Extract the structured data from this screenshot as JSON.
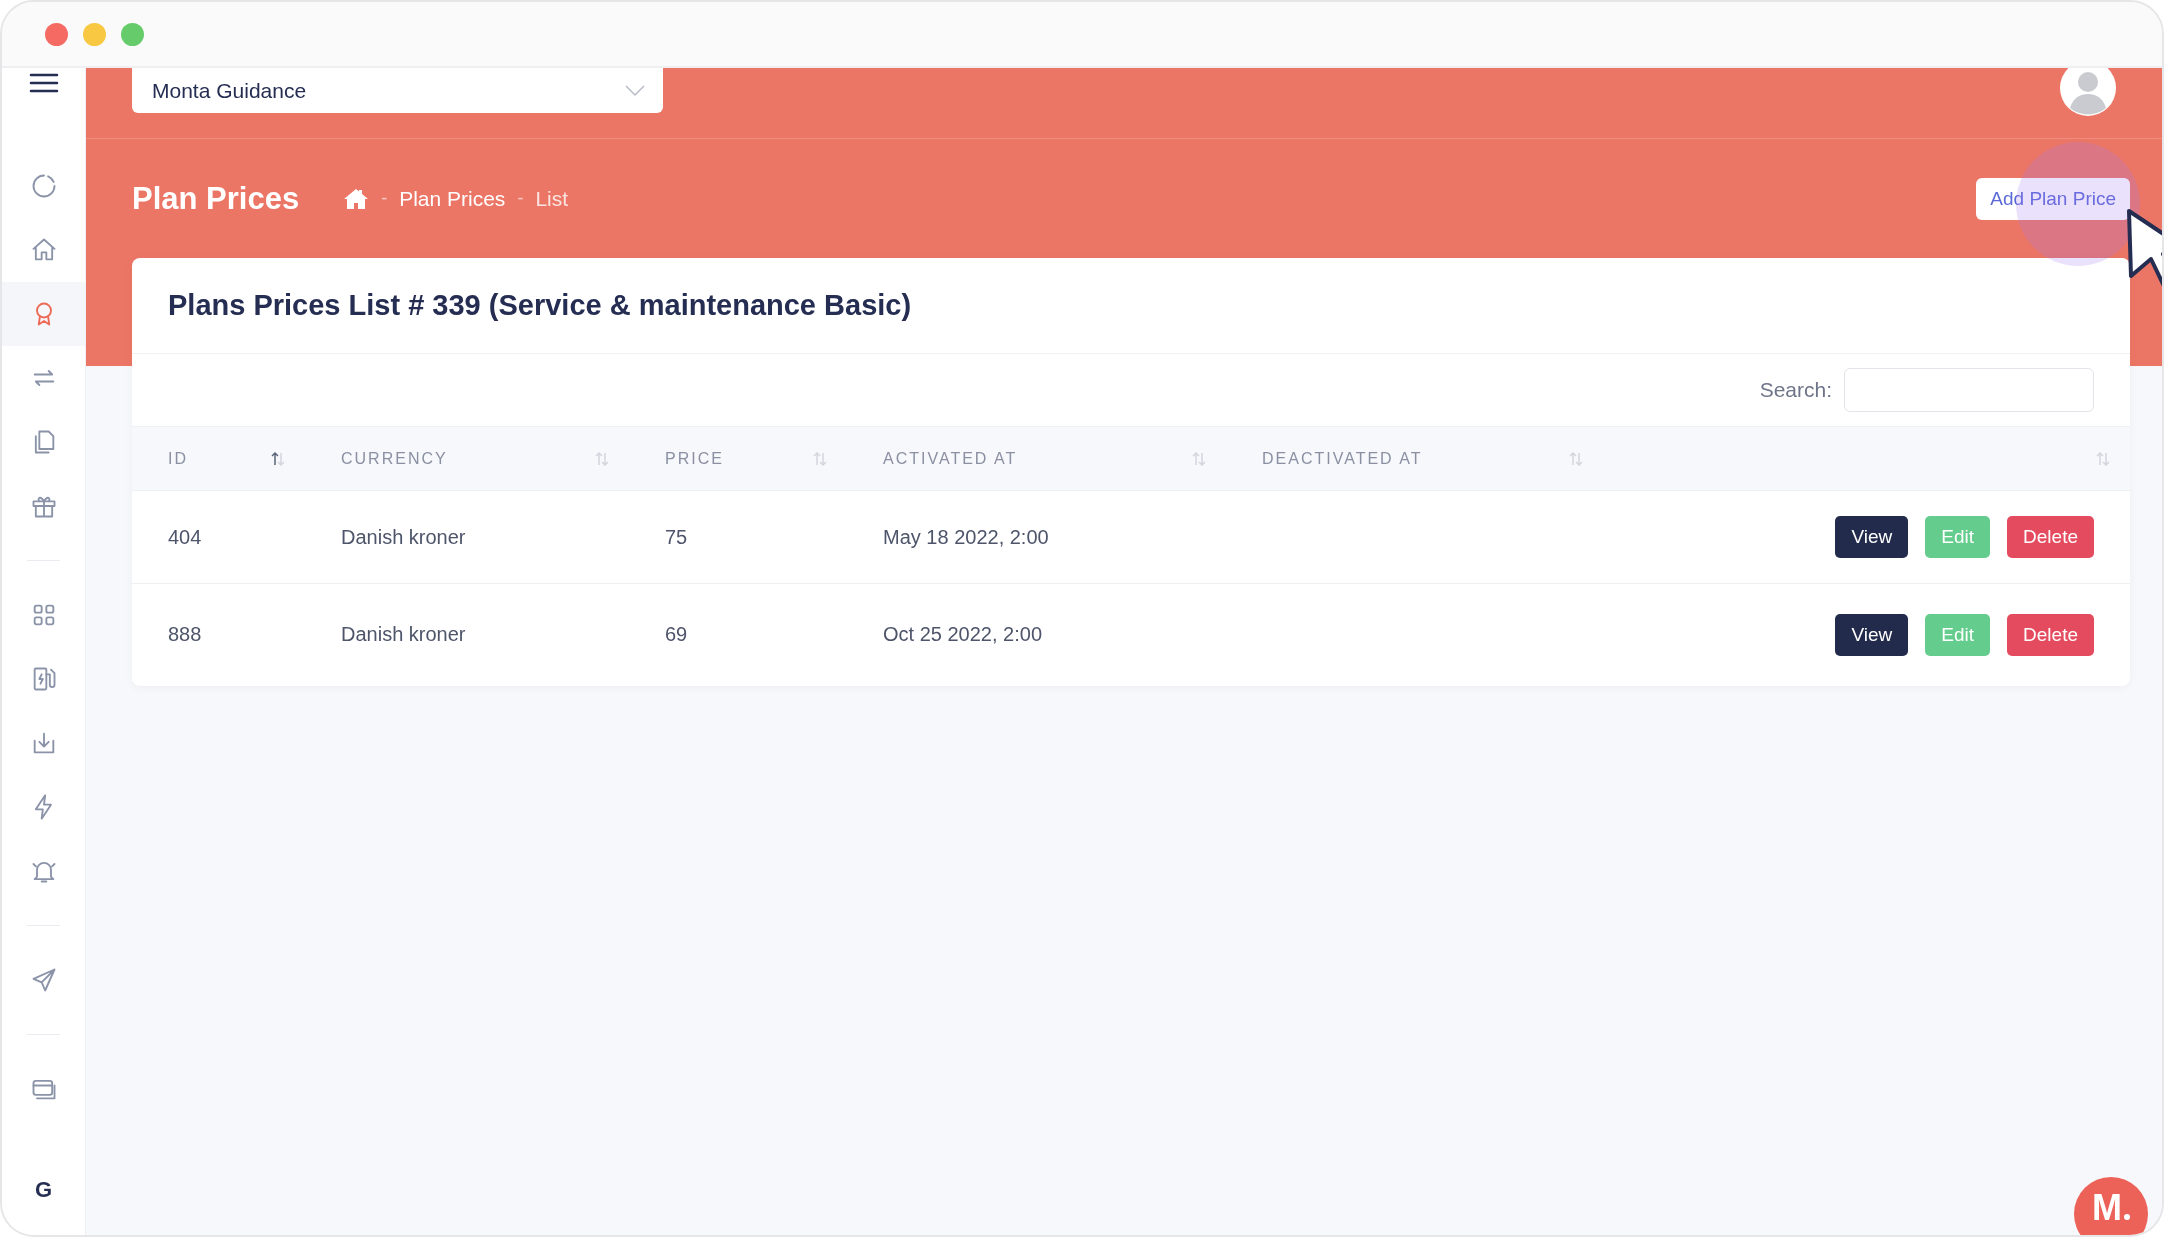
{
  "topbar": {
    "account_selector": {
      "value": "Monta Guidance"
    }
  },
  "sidebar": {
    "groups": [
      [
        {
          "selected": false
        },
        {
          "selected": false
        },
        {
          "selected": true
        },
        {
          "selected": false
        },
        {
          "selected": false
        },
        {
          "selected": false
        }
      ],
      [
        {
          "selected": false
        },
        {
          "selected": false
        },
        {
          "selected": false
        },
        {
          "selected": false
        },
        {
          "selected": false
        }
      ],
      [
        {
          "selected": false
        }
      ],
      [
        {
          "selected": false
        }
      ]
    ],
    "footer_text": "G"
  },
  "page_header": {
    "title": "Plan Prices",
    "breadcrumb": [
      {
        "separator": "-",
        "label": "Plan Prices"
      },
      {
        "separator": "-",
        "label": "List"
      }
    ],
    "action": "Add Plan Price"
  },
  "card": {
    "title": "Plans Prices List # 339 (Service & maintenance Basic)",
    "search": {
      "label": "Search:"
    },
    "columns": [
      {
        "label": "ID",
        "sorted": true
      },
      {
        "label": "CURRENCY",
        "sorted": false
      },
      {
        "label": "PRICE",
        "sorted": false
      },
      {
        "label": "ACTIVATED AT",
        "sorted": false
      },
      {
        "label": "DEACTIVATED AT",
        "sorted": false
      },
      {
        "sorted": false
      }
    ],
    "rows": [
      {
        "cells": [
          "404",
          "Danish kroner",
          "75",
          "May 18 2022, 2:00"
        ],
        "actions": [
          {
            "label": "View",
            "kind": "primary"
          },
          {
            "label": "Edit",
            "kind": "success"
          },
          {
            "label": "Delete",
            "kind": "danger"
          }
        ]
      },
      {
        "cells": [
          "888",
          "Danish kroner",
          "69",
          "Oct 25 2022, 2:00"
        ],
        "actions": [
          {
            "label": "View",
            "kind": "primary"
          },
          {
            "label": "Edit",
            "kind": "success"
          },
          {
            "label": "Delete",
            "kind": "danger"
          }
        ]
      }
    ]
  },
  "help_button": {
    "label": "M"
  }
}
